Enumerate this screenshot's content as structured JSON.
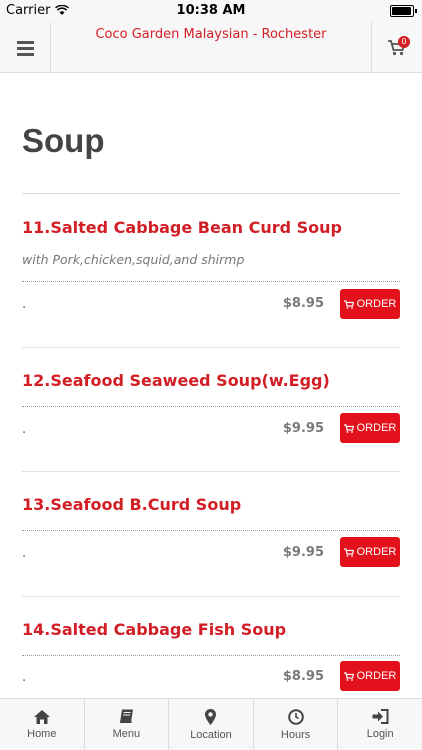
{
  "status_bar": {
    "carrier": "Carrier",
    "time": "10:38 AM"
  },
  "nav": {
    "title": "Coco Garden Malaysian - Rochester",
    "cart_count": "0"
  },
  "section": {
    "title": "Soup"
  },
  "items": [
    {
      "name": "11.Salted Cabbage Bean Curd Soup",
      "description": "with Pork,chicken,squid,and shirmp",
      "dot": ".",
      "price": "$8.95",
      "order_label": "ORDER"
    },
    {
      "name": "12.Seafood Seaweed Soup(w.Egg)",
      "dot": ".",
      "price": "$9.95",
      "order_label": "ORDER"
    },
    {
      "name": "13.Seafood B.Curd Soup",
      "dot": ".",
      "price": "$9.95",
      "order_label": "ORDER"
    },
    {
      "name": "14.Salted Cabbage Fish Soup",
      "dot": ".",
      "price": "$8.95",
      "order_label": "ORDER"
    }
  ],
  "tabs": [
    {
      "label": "Home",
      "icon": "home-icon"
    },
    {
      "label": "Menu",
      "icon": "book-icon"
    },
    {
      "label": "Location",
      "icon": "map-pin-icon"
    },
    {
      "label": "Hours",
      "icon": "clock-icon"
    },
    {
      "label": "Login",
      "icon": "login-icon"
    }
  ],
  "colors": {
    "accent": "#d21e25",
    "order_button": "#e3111b"
  }
}
